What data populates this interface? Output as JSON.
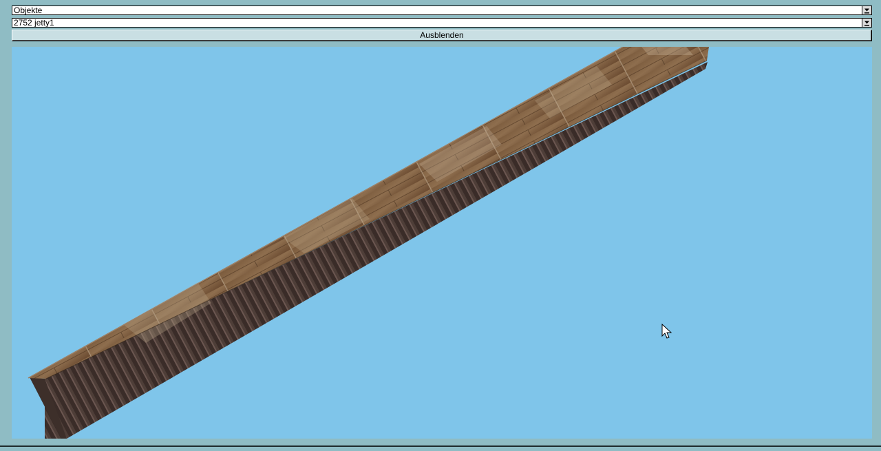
{
  "category_select": {
    "value": "Objekte"
  },
  "object_select": {
    "value": "2752 jetty1"
  },
  "toggle_button": {
    "label": "Ausblenden"
  },
  "viewport": {
    "background_color": "#7fc5ea",
    "object": "jetty1",
    "icon": "mouse-pointer-icon"
  },
  "colors": {
    "window_bg": "#8fbcc4",
    "button_bg": "#c9dfe3",
    "wood_top_light": "#8a6a48",
    "wood_top_dark": "#5c4128",
    "wood_side": "#4a3a34"
  }
}
